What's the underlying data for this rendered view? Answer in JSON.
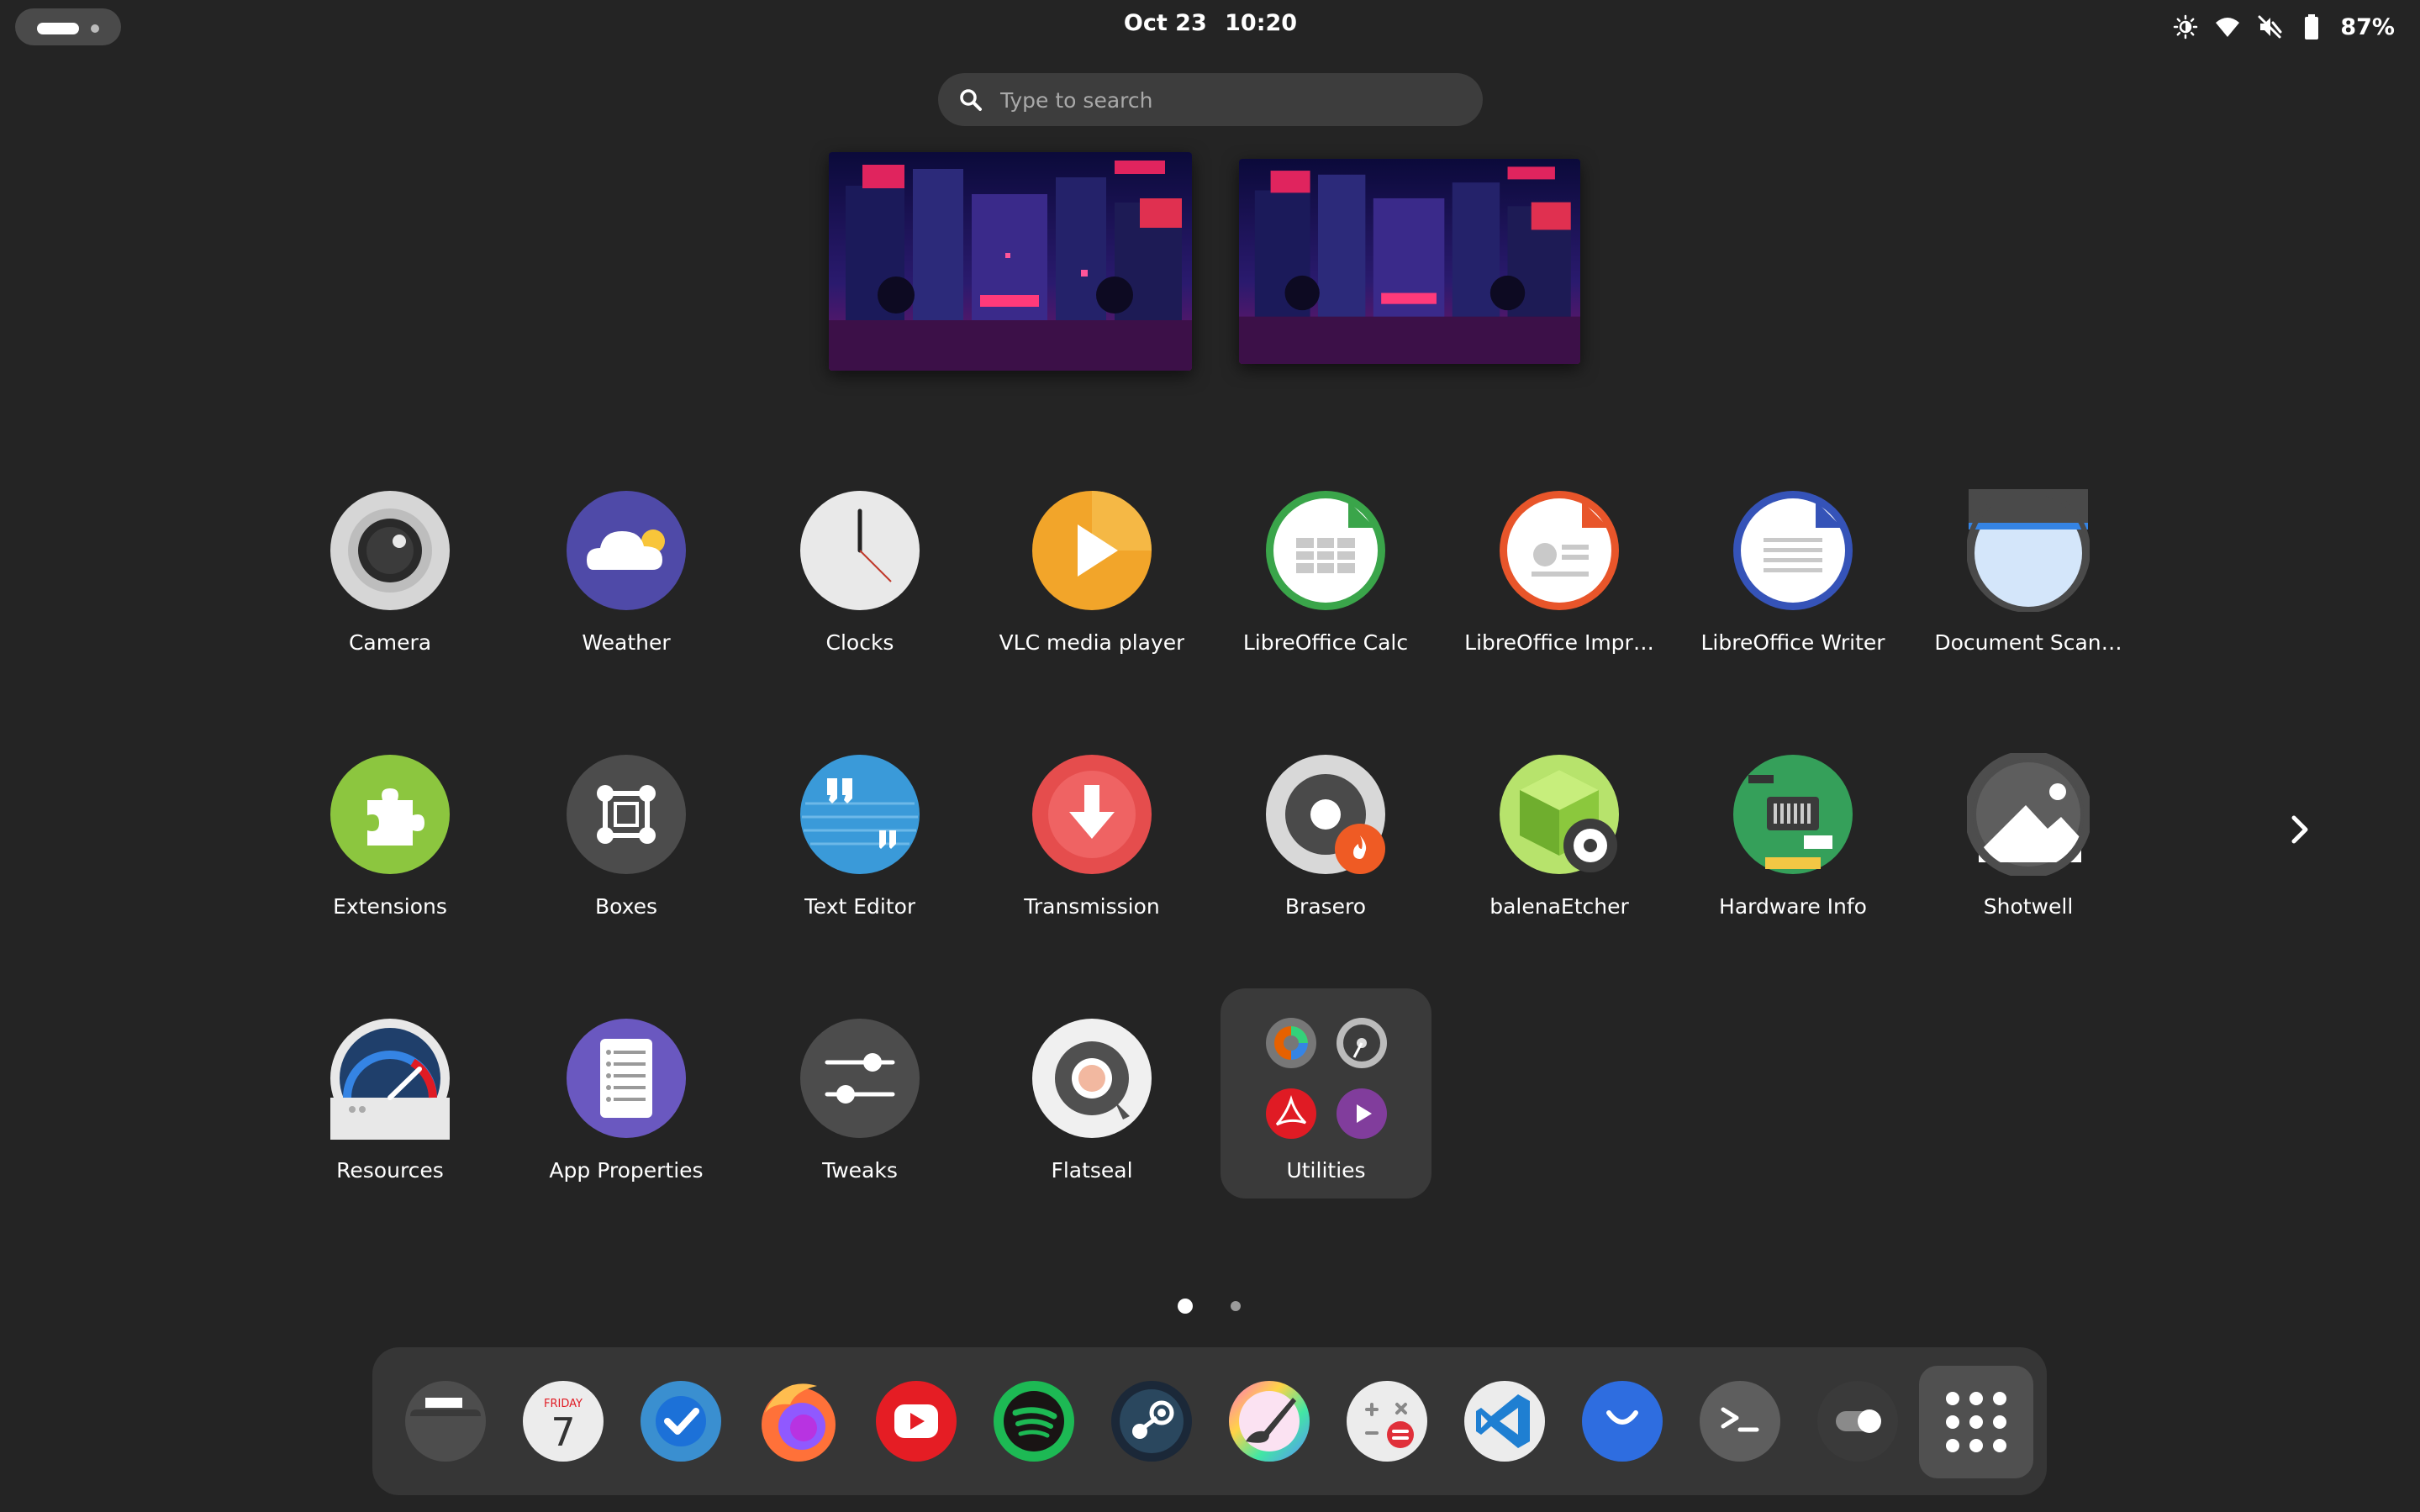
{
  "topbar": {
    "date": "Oct 23",
    "time": "10:20",
    "battery_percent": "87%",
    "status_icons": [
      "night-light-icon",
      "wifi-icon",
      "volume-muted-icon",
      "battery-icon"
    ]
  },
  "search": {
    "placeholder": "Type to search"
  },
  "workspaces": [
    "workspace-1",
    "workspace-2"
  ],
  "apps": {
    "camera": "Camera",
    "weather": "Weather",
    "clocks": "Clocks",
    "vlc": "VLC media player",
    "calc": "LibreOffice Calc",
    "impress": "LibreOffice Impr…",
    "writer": "LibreOffice Writer",
    "docscan": "Document Scan…",
    "extensions": "Extensions",
    "boxes": "Boxes",
    "texteditor": "Text Editor",
    "transmission": "Transmission",
    "brasero": "Brasero",
    "etcher": "balenaEtcher",
    "hwinfo": "Hardware Info",
    "shotwell": "Shotwell",
    "resources": "Resources",
    "appprops": "App Properties",
    "tweaks": "Tweaks",
    "flatseal": "Flatseal",
    "utilities": "Utilities"
  },
  "pager": {
    "current_page": 1,
    "total_pages": 2
  },
  "dock": {
    "items": [
      "Files",
      "Calendar",
      "Tasks",
      "Firefox",
      "YouTube",
      "Spotify",
      "Steam",
      "Paint",
      "Calculator",
      "Visual Studio Code",
      "Ulauncher",
      "Terminal",
      "Toggle Settings",
      "Show Apps"
    ],
    "calendar_day": "FRIDAY",
    "calendar_date": "7"
  },
  "colors": {
    "background": "#242424",
    "panel": "#363636",
    "folder": "#3a3a3a",
    "search": "#3d3d3d"
  }
}
